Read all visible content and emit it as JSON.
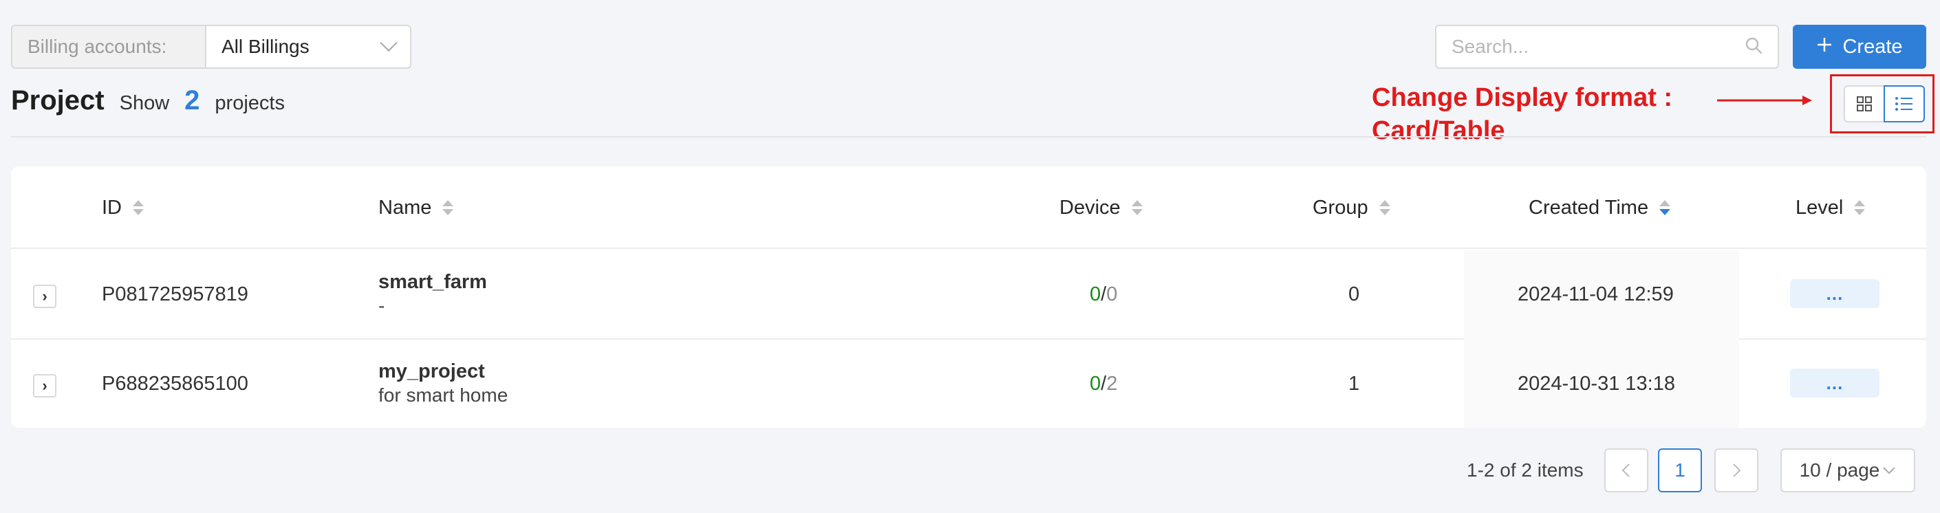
{
  "billing": {
    "label": "Billing accounts:",
    "selected": "All Billings"
  },
  "search": {
    "placeholder": "Search..."
  },
  "create": {
    "label": "Create"
  },
  "header": {
    "title": "Project",
    "show_text": "Show",
    "count": "2",
    "count_unit": "projects"
  },
  "annotation": {
    "line1": "Change Display format :",
    "line2": "Card/Table",
    "color": "#e01c1c"
  },
  "table": {
    "columns": [
      "ID",
      "Name",
      "Device",
      "Group",
      "Created Time",
      "Level"
    ],
    "rows": [
      {
        "id": "P081725957819",
        "name": "smart_farm",
        "desc": "-",
        "device_online": "0",
        "device_total": "0",
        "group": "0",
        "created": "2024-11-04 12:59",
        "level": "..."
      },
      {
        "id": "P688235865100",
        "name": "my_project",
        "desc": "for smart home",
        "device_online": "0",
        "device_total": "2",
        "group": "1",
        "created": "2024-10-31 13:18",
        "level": "..."
      }
    ]
  },
  "pagination": {
    "total_text": "1-2 of 2 items",
    "current_page": "1",
    "page_size": "10 / page"
  },
  "colors": {
    "accent": "#2f7fd8",
    "online": "#1a8a1a",
    "background": "#f4f5f9"
  }
}
